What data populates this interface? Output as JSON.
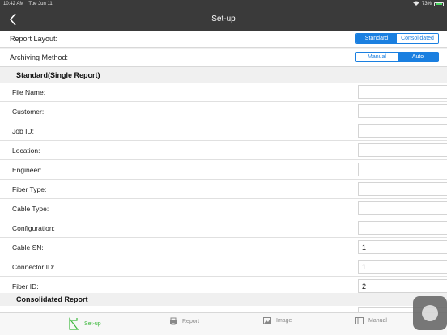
{
  "status": {
    "time": "10:42 AM",
    "date": "Tue Jun 11",
    "battery": "73%"
  },
  "nav": {
    "title": "Set-up"
  },
  "report_layout": {
    "label": "Report Layout:",
    "options": [
      "Standard",
      "Consolidated"
    ],
    "selected": "Standard"
  },
  "archiving": {
    "label": "Archiving Method:",
    "options": [
      "Manual",
      "Auto"
    ],
    "selected": "Auto"
  },
  "standard_section": {
    "title": "Standard(Single Report)"
  },
  "fields": [
    {
      "label": "File Name:",
      "value": ""
    },
    {
      "label": "Customer:",
      "value": ""
    },
    {
      "label": "Job ID:",
      "value": ""
    },
    {
      "label": "Location:",
      "value": ""
    },
    {
      "label": "Engineer:",
      "value": ""
    },
    {
      "label": "Fiber Type:",
      "value": ""
    },
    {
      "label": "Cable Type:",
      "value": ""
    },
    {
      "label": "Configuration:",
      "value": ""
    },
    {
      "label": "Cable SN:",
      "value": "1"
    },
    {
      "label": "Connector ID:",
      "value": "1"
    },
    {
      "label": "Fiber ID:",
      "value": "2"
    }
  ],
  "consolidated_section": {
    "title": "Consolidated Report"
  },
  "tabs": [
    {
      "label": "Set-up",
      "icon": "setup-icon",
      "active": true
    },
    {
      "label": "Report",
      "icon": "printer-icon",
      "active": false
    },
    {
      "label": "Image",
      "icon": "image-icon",
      "active": false
    },
    {
      "label": "Manual",
      "icon": "book-icon",
      "active": false
    }
  ],
  "colors": {
    "accent": "#1a7fe0",
    "active_tab": "#3cb83c",
    "bar": "#3a3a3a"
  }
}
